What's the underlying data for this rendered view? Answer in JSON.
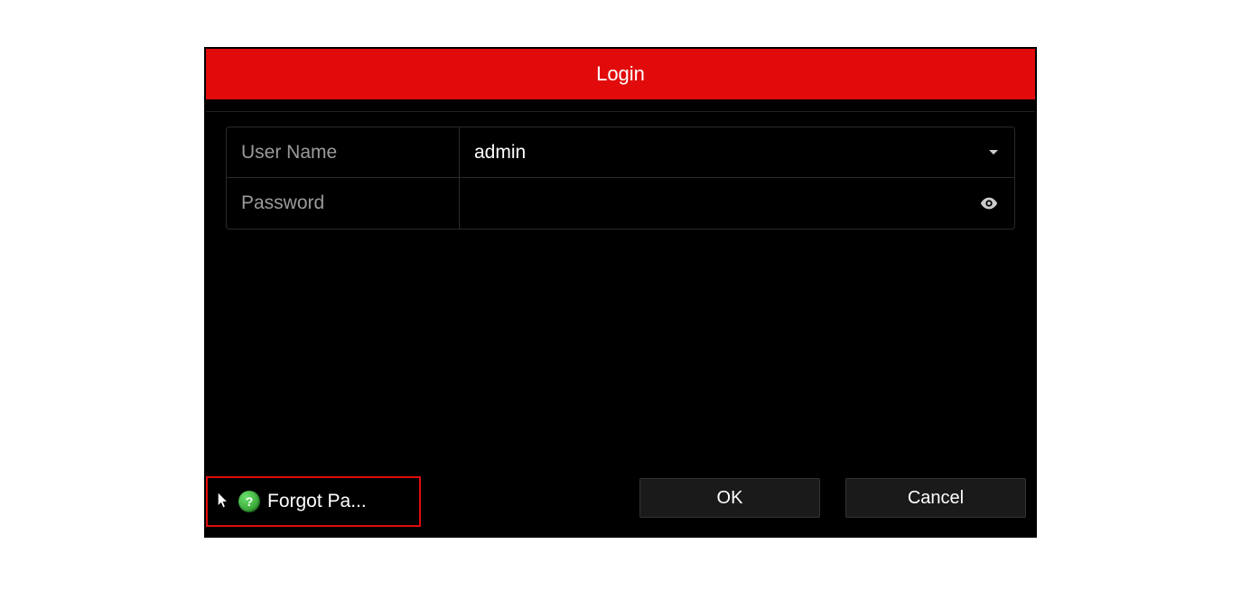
{
  "dialog": {
    "title": "Login"
  },
  "form": {
    "username": {
      "label": "User Name",
      "value": "admin"
    },
    "password": {
      "label": "Password",
      "value": ""
    }
  },
  "footer": {
    "forgot_label": "Forgot Pa...",
    "ok_label": "OK",
    "cancel_label": "Cancel",
    "help_symbol": "?"
  }
}
